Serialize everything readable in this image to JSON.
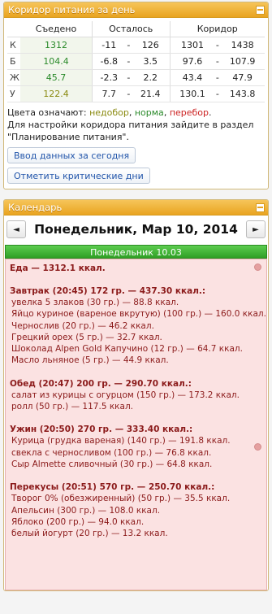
{
  "corridor": {
    "title": "Коридор питания за день",
    "headers": [
      "Съедено",
      "Осталось",
      "Коридор"
    ],
    "rows": [
      {
        "letter": "К",
        "eaten": "1312",
        "rem_a": "-11",
        "rem_b": "126",
        "cor_a": "1301",
        "cor_b": "1438",
        "color": "#2a8a2a"
      },
      {
        "letter": "Б",
        "eaten": "104.4",
        "rem_a": "-6.8",
        "rem_b": "3.5",
        "cor_a": "97.6",
        "cor_b": "107.9",
        "color": "#2a8a2a"
      },
      {
        "letter": "Ж",
        "eaten": "45.7",
        "rem_a": "-2.3",
        "rem_b": "2.2",
        "cor_a": "43.4",
        "cor_b": "47.9",
        "color": "#2a8a2a"
      },
      {
        "letter": "У",
        "eaten": "122.4",
        "rem_a": "7.7",
        "rem_b": "21.4",
        "cor_a": "130.1",
        "cor_b": "143.8",
        "color": "#8a8a10"
      }
    ],
    "dash": "-",
    "legend_prefix": "Цвета означают:",
    "legend_under": "недобор",
    "legend_norm": "норма",
    "legend_over": "перебор",
    "legend_comma": ",",
    "legend_dot": ".",
    "settings_note": "Для настройки коридора питания зайдите в раздел \"Планирование питания\".",
    "btn_today": "Ввод данных за сегодня",
    "btn_critical": "Отметить критические дни"
  },
  "calendar": {
    "title": "Календарь",
    "prev": "◄",
    "next": "►",
    "date": "Понедельник, Мар 10, 2014",
    "day_label": "Понедельник 10.03",
    "food_total": "Еда — 1312.1 ккал.",
    "meals": [
      {
        "head": "Завтрак (20:45) 172 гр. — 437.30 ккал.:",
        "items": [
          "увелка 5 злаков (30 гр.) — 88.8 ккал.",
          "Яйцо куриное (вареное вкрутую) (100 гр.) — 160.0 ккал.",
          "Чернослив (20 гр.) — 46.2 ккал.",
          "Грецкий орех (5 гр.) — 32.7 ккал.",
          "Шоколад Alpen Gold Капучино (12 гр.) — 64.7 ккал.",
          "Масло льняное (5 гр.) — 44.9 ккал."
        ]
      },
      {
        "head": "Обед (20:47) 200 гр. — 290.70 ккал.:",
        "items": [
          "салат из курицы с огурцом (150 гр.) — 173.2 ккал.",
          "ролл (50 гр.) — 117.5 ккал."
        ]
      },
      {
        "head": "Ужин (20:50) 270 гр. — 333.40 ккал.:",
        "items": [
          "Курица (грудка вареная) (140 гр.) — 191.8 ккал.",
          "свекла с черносливом (100 гр.) — 76.8 ккал.",
          "Сыр Almette сливочный (30 гр.) — 64.8 ккал."
        ]
      },
      {
        "head": "Перекусы (20:51) 570 гр. — 250.70 ккал.:",
        "items": [
          "Творог 0% (обезжиренный) (50 гр.) — 35.5 ккал.",
          "Апельсин (300 гр.) — 108.0 ккал.",
          "Яблоко (200 гр.) — 94.0 ккал.",
          "белый йогурт (20 гр.) — 13.2 ккал."
        ]
      }
    ]
  }
}
